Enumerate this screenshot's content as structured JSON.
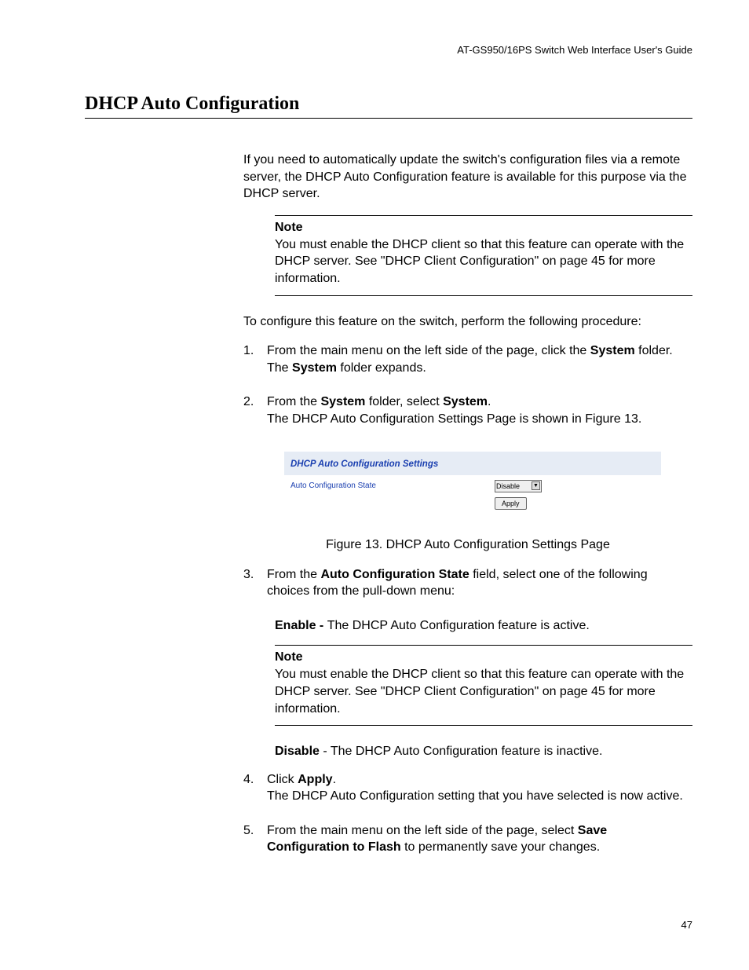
{
  "header": {
    "running": "AT-GS950/16PS Switch Web Interface User's Guide"
  },
  "section_title": "DHCP Auto Configuration",
  "intro": "If you need to automatically update the switch's configuration files via a remote server, the DHCP Auto Configuration feature is available for this purpose via the DHCP server.",
  "note1": {
    "title": "Note",
    "body": "You must enable the DHCP client so that this feature can operate with the DHCP server. See \"DHCP Client Configuration\" on page 45 for more information."
  },
  "lead_in": "To configure this feature on the switch, perform the following procedure:",
  "steps": {
    "s1": {
      "num": "1.",
      "l1a": "From the main menu on the left side of the page, click the ",
      "l1b": "System",
      "l1c": " folder.",
      "l2a": "The ",
      "l2b": "System",
      "l2c": " folder expands."
    },
    "s2": {
      "num": "2.",
      "l1a": "From the ",
      "l1b": "System",
      "l1c": " folder, select ",
      "l1d": "System",
      "l1e": ".",
      "l2": "The DHCP Auto Configuration Settings Page is shown in Figure 13."
    },
    "s3": {
      "num": "3.",
      "l1a": "From the ",
      "l1b": "Auto Configuration State",
      "l1c": " field, select one of the following choices from the pull-down menu:"
    },
    "enable": {
      "label": "Enable - ",
      "text": "The DHCP Auto Configuration feature is active."
    },
    "disable": {
      "label": "Disable",
      "text": " - The DHCP Auto Configuration feature is inactive."
    },
    "s4": {
      "num": "4.",
      "l1a": "Click ",
      "l1b": "Apply",
      "l1c": ".",
      "l2": "The DHCP Auto Configuration setting that you have selected is now active."
    },
    "s5": {
      "num": "5.",
      "l1a": "From the main menu on the left side of the page, select ",
      "l1b": "Save Configuration to Flash",
      "l1c": " to permanently save your changes."
    }
  },
  "note2": {
    "title": "Note",
    "body": "You must enable the DHCP client so that this feature can operate with the DHCP server. See \"DHCP Client Configuration\" on page 45 for more information."
  },
  "figure": {
    "panel_title": "DHCP Auto Configuration Settings",
    "field_label": "Auto Configuration State",
    "select_value": "Disable",
    "apply_label": "Apply",
    "caption": "Figure 13. DHCP Auto Configuration Settings Page"
  },
  "page_number": "47"
}
